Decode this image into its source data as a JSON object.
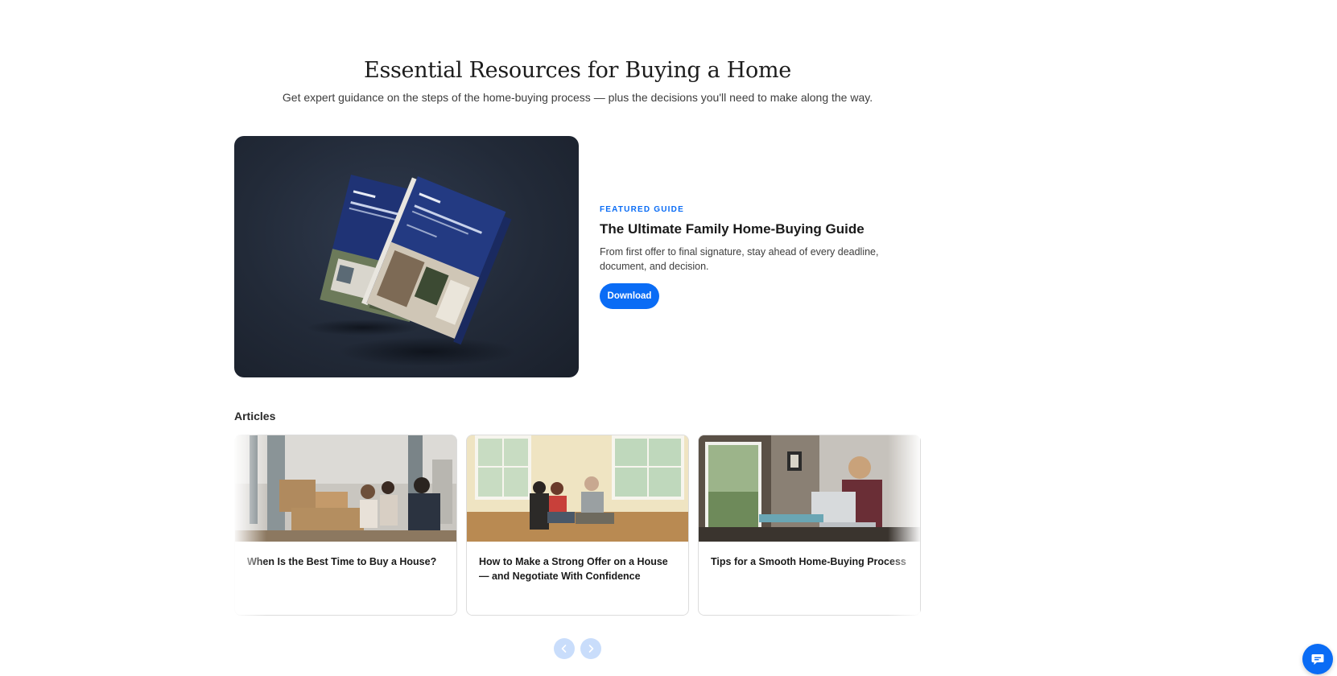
{
  "hero": {
    "title": "Essential Resources for Buying a Home",
    "subtitle": "Get expert guidance on the steps of the home-buying process — plus the decisions you'll need to make along the way."
  },
  "featured": {
    "eyebrow": "FEATURED GUIDE",
    "title": "The Ultimate Family Home-Buying Guide",
    "description": "From first offer to final signature, stay ahead of every deadline, document, and decision.",
    "button_label": "Download",
    "image_alt": "Home-Buying Guide for Families book mockup"
  },
  "articles": {
    "heading": "Articles",
    "items": [
      {
        "title": "When Is the Best Time to Buy a House?"
      },
      {
        "title": "How to Make a Strong Offer on a House — and Negotiate With Confidence"
      },
      {
        "title": "Tips for a Smooth Home-Buying Process"
      }
    ]
  },
  "carousel": {
    "prev_icon": "chevron-left-icon",
    "next_icon": "chevron-right-icon"
  },
  "chat": {
    "icon": "chat-bubble-icon"
  },
  "colors": {
    "accent": "#0a6cf5",
    "nav_button": "#c9ddfb",
    "featured_bg": "#222a38"
  }
}
